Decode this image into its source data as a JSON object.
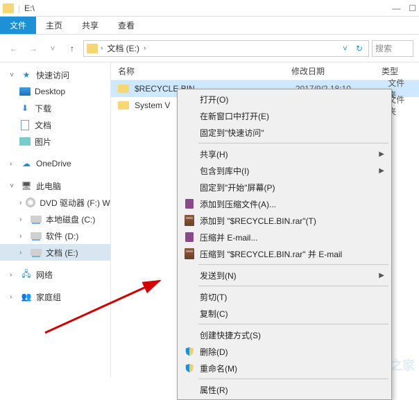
{
  "titlebar": {
    "title": "E:\\"
  },
  "menubar": {
    "file": "文件",
    "home": "主页",
    "share": "共享",
    "view": "查看"
  },
  "toolbar": {
    "breadcrumb": {
      "root": "文档 (E:)"
    },
    "search_placeholder": "搜索"
  },
  "sidebar": {
    "quick_access": "快速访问",
    "desktop": "Desktop",
    "downloads": "下载",
    "documents": "文档",
    "pictures": "图片",
    "onedrive": "OneDrive",
    "this_pc": "此电脑",
    "dvd": "DVD 驱动器 (F:) WIN",
    "localdisk_c": "本地磁盘 (C:)",
    "software_d": "软件 (D:)",
    "documents_e": "文档 (E:)",
    "network": "网络",
    "homegroup": "家庭组"
  },
  "filelist": {
    "headers": {
      "name": "名称",
      "date": "修改日期",
      "type": "类型"
    },
    "rows": [
      {
        "name": "$RECYCLE.BIN",
        "date": "2017/9/2 18:10",
        "type": "文件夹"
      },
      {
        "name": "System V",
        "date": "",
        "type": "文件夹"
      }
    ]
  },
  "context_menu": {
    "open": "打开(O)",
    "open_new_window": "在新窗口中打开(E)",
    "pin_quick": "固定到\"快速访问\"",
    "share": "共享(H)",
    "include_library": "包含到库中(I)",
    "pin_start": "固定到\"开始\"屏幕(P)",
    "add_archive": "添加到压缩文件(A)...",
    "add_rar": "添加到 \"$RECYCLE.BIN.rar\"(T)",
    "compress_email": "压缩并 E-mail...",
    "compress_rar_email": "压缩到 \"$RECYCLE.BIN.rar\" 并 E-mail",
    "send_to": "发送到(N)",
    "cut": "剪切(T)",
    "copy": "复制(C)",
    "create_shortcut": "创建快捷方式(S)",
    "delete": "删除(D)",
    "rename": "重命名(M)",
    "properties": "属性(R)"
  },
  "watermark": "系统之家"
}
